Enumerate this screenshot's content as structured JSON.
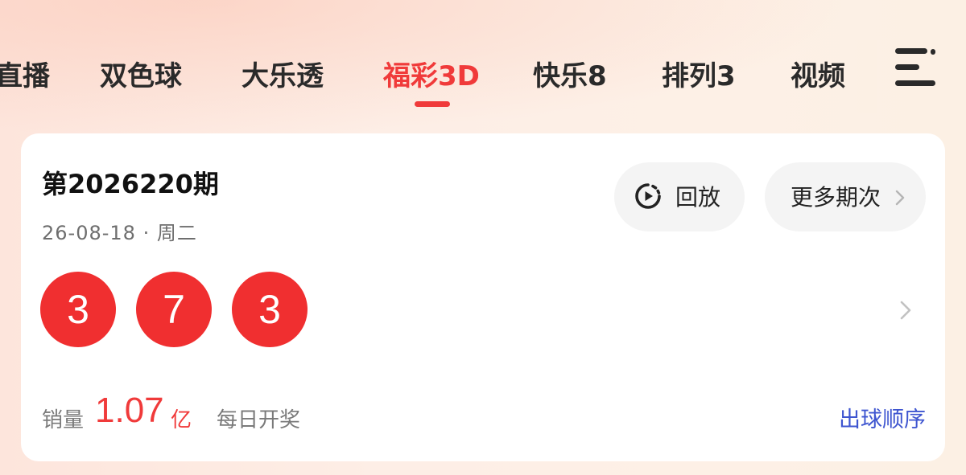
{
  "tabs": [
    {
      "label": "直播",
      "active": false
    },
    {
      "label": "双色球",
      "active": false
    },
    {
      "label": "大乐透",
      "active": false
    },
    {
      "label": "福彩3D",
      "active": true
    },
    {
      "label": "快乐8",
      "active": false
    },
    {
      "label": "排列3",
      "active": false
    },
    {
      "label": "视频",
      "active": false
    }
  ],
  "menu": {
    "icon": "hamburger-menu-icon"
  },
  "draw": {
    "issue": "第2026220期",
    "date": "26-08-18 · 周二",
    "balls": [
      "3",
      "7",
      "3"
    ],
    "replay_label": "回放",
    "replay_icon": "play-replay-icon",
    "more_label": "更多期次",
    "sales_label": "销量",
    "sales_value": "1.07",
    "sales_unit": "亿",
    "frequency": "每日开奖",
    "draw_order_label": "出球顺序"
  },
  "colors": {
    "accent": "#f03a3a",
    "ball": "#f02f30",
    "link": "#3e55d0"
  }
}
